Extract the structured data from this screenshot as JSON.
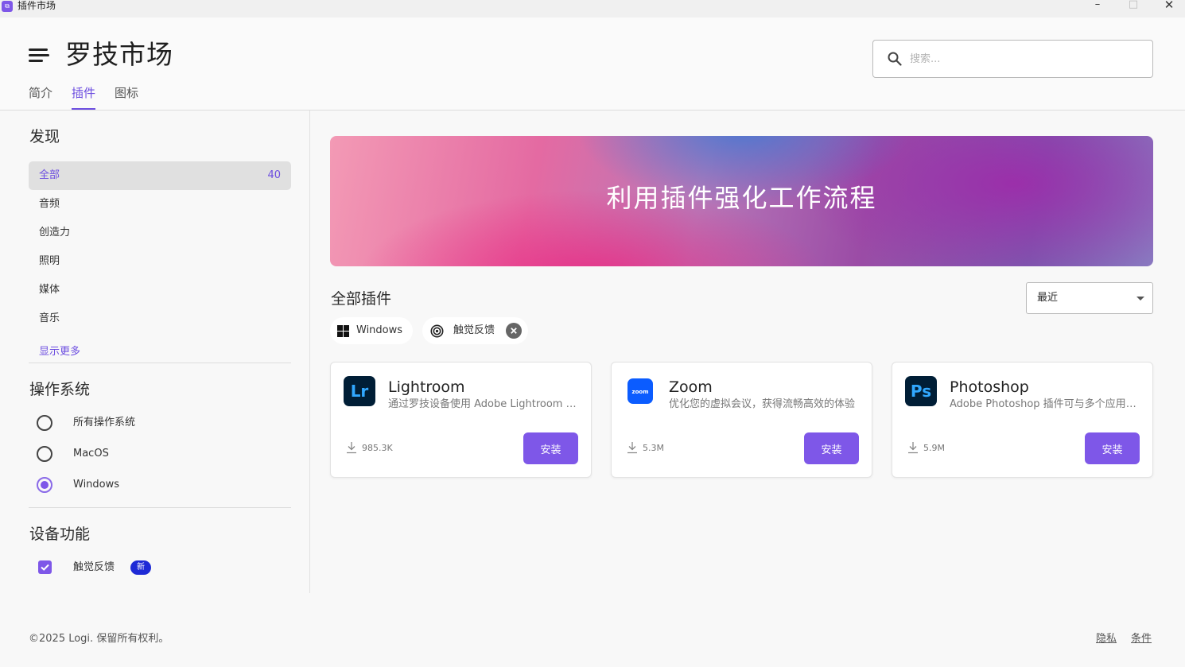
{
  "window": {
    "title": "插件市场",
    "app_icon_text": "Logi",
    "minimize_icon": "minimize-icon",
    "maximize_icon": "maximize-icon",
    "close_icon": "close-icon"
  },
  "header": {
    "title": "罗技市场",
    "menu_icon": "hamburger-menu-icon",
    "tabs": [
      {
        "label": "简介",
        "active": false
      },
      {
        "label": "插件",
        "active": true
      },
      {
        "label": "图标",
        "active": false
      }
    ],
    "search": {
      "placeholder": "搜索...",
      "icon": "search-icon"
    }
  },
  "sidebar": {
    "discover_title": "发现",
    "categories": [
      {
        "label": "全部",
        "count": "40",
        "selected": true
      },
      {
        "label": "音频"
      },
      {
        "label": "创造力"
      },
      {
        "label": "照明"
      },
      {
        "label": "媒体"
      },
      {
        "label": "音乐"
      }
    ],
    "show_more": "显示更多",
    "os_title": "操作系统",
    "os_options": [
      {
        "label": "所有操作系统",
        "checked": false
      },
      {
        "label": "MacOS",
        "checked": false
      },
      {
        "label": "Windows",
        "checked": true
      }
    ],
    "features_title": "设备功能",
    "features": [
      {
        "label": "触觉反馈",
        "checked": true,
        "badge": "新"
      }
    ]
  },
  "main": {
    "banner_text": "利用插件强化工作流程",
    "list_title": "全部插件",
    "sort": {
      "value": "最近"
    },
    "filters": [
      {
        "label": "Windows",
        "icon": "windows-icon",
        "removable": false
      },
      {
        "label": "触觉反馈",
        "icon": "haptic-icon",
        "removable": true
      }
    ],
    "plugins": [
      {
        "name": "Lightroom",
        "logo_text": "Lr",
        "logo_color": "#001e36",
        "logo_text_color": "#31a8ff",
        "description": "通过罗技设备使用 Adobe Lightroom Classic",
        "downloads": "985.3K",
        "install_label": "安装"
      },
      {
        "name": "Zoom",
        "logo_text": "zoom",
        "logo_color": "#0b5cff",
        "logo_text_color": "#ffffff",
        "description": "优化您的虚拟会议，获得流畅高效的体验",
        "downloads": "5.3M",
        "install_label": "安装"
      },
      {
        "name": "Photoshop",
        "logo_text": "Ps",
        "logo_color": "#001e36",
        "logo_text_color": "#31a8ff",
        "description": "Adobe Photoshop 插件可与多个应用配合使用",
        "downloads": "5.9M",
        "install_label": "安装"
      }
    ]
  },
  "footer": {
    "copyright": "©2025 Logi. 保留所有权利。",
    "links": [
      "隐私",
      "条件"
    ]
  },
  "colors": {
    "accent": "#7e57e8",
    "badge": "#1e2ad6"
  }
}
